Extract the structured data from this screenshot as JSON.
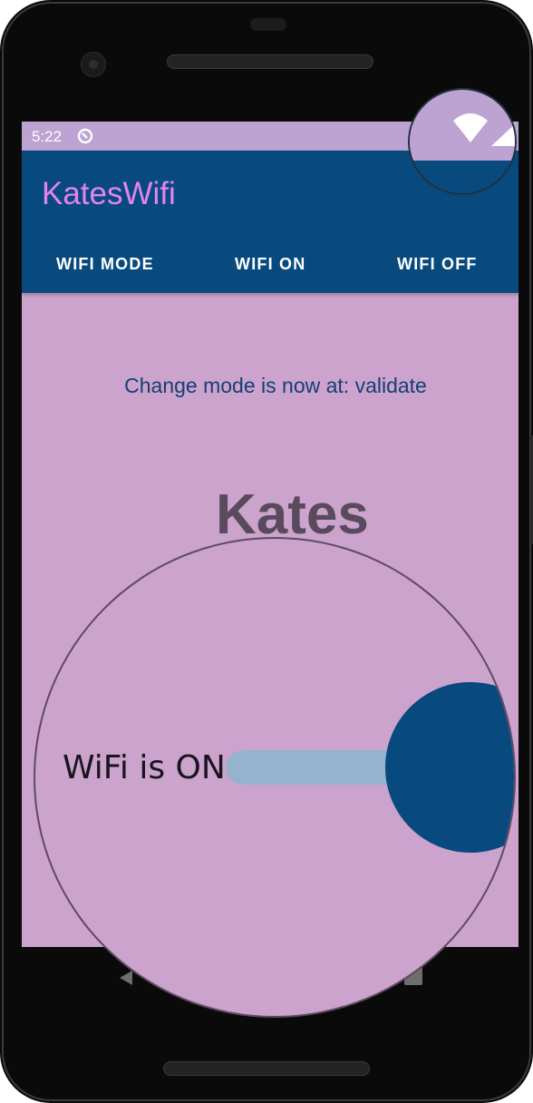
{
  "status_bar": {
    "time": "5:22",
    "icons": [
      "sync-icon",
      "wifi-icon",
      "signal-icon"
    ]
  },
  "app_bar": {
    "title": "KatesWifi",
    "menu": [
      {
        "label": "WIFI MODE"
      },
      {
        "label": "WIFI ON"
      },
      {
        "label": "WIFI OFF"
      }
    ]
  },
  "main": {
    "mode_message": "Change mode is now at: validate",
    "heading": "Kates",
    "wifi_switch": {
      "label": "WiFi is ON",
      "checked": true
    }
  },
  "nav_bar": {
    "icons": [
      "back-icon",
      "recent-apps-icon"
    ]
  },
  "colors": {
    "background": "#CBA3CD",
    "status_bar": "#BDA3D2",
    "app_bar": "#084A7E",
    "title": "#E383F0",
    "message": "#153F74",
    "switch_thumb": "#084A7E",
    "switch_track": "#96B3CD"
  }
}
